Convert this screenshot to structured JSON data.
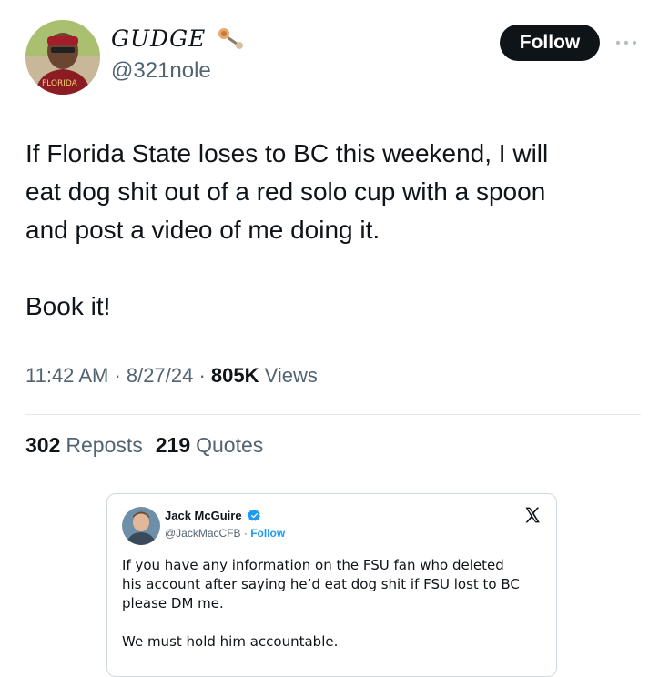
{
  "tweet": {
    "display_name": "GUDGE",
    "handle": "@321nole",
    "follow_label": "Follow",
    "text": "If Florida State loses to BC this weekend, I will\neat dog shit out of a red solo cup with a spoon\nand post a video of me doing it.\n\nBook it!",
    "time": "11:42 AM",
    "date": "8/27/24",
    "views_count": "805K",
    "views_label": "Views",
    "reposts_count": "302",
    "reposts_label": "Reposts",
    "quotes_count": "219",
    "quotes_label": "Quotes",
    "avatar_jersey_text": "FLORIDA"
  },
  "embedded": {
    "name": "Jack McGuire",
    "handle": "@JackMacCFB",
    "separator": "·",
    "follow_label": "Follow",
    "text": "If you have any information on the FSU fan who deleted\nhis account after saying he’d eat dog shit if FSU lost to BC\nplease DM me.\n\nWe must hold him accountable."
  },
  "colors": {
    "accent": "#1d9bf0",
    "text": "#0f1419",
    "muted": "#536471",
    "button": "#0f1419"
  },
  "icons": [
    "emoji-icon",
    "more-icon",
    "verified-icon",
    "x-logo-icon"
  ]
}
